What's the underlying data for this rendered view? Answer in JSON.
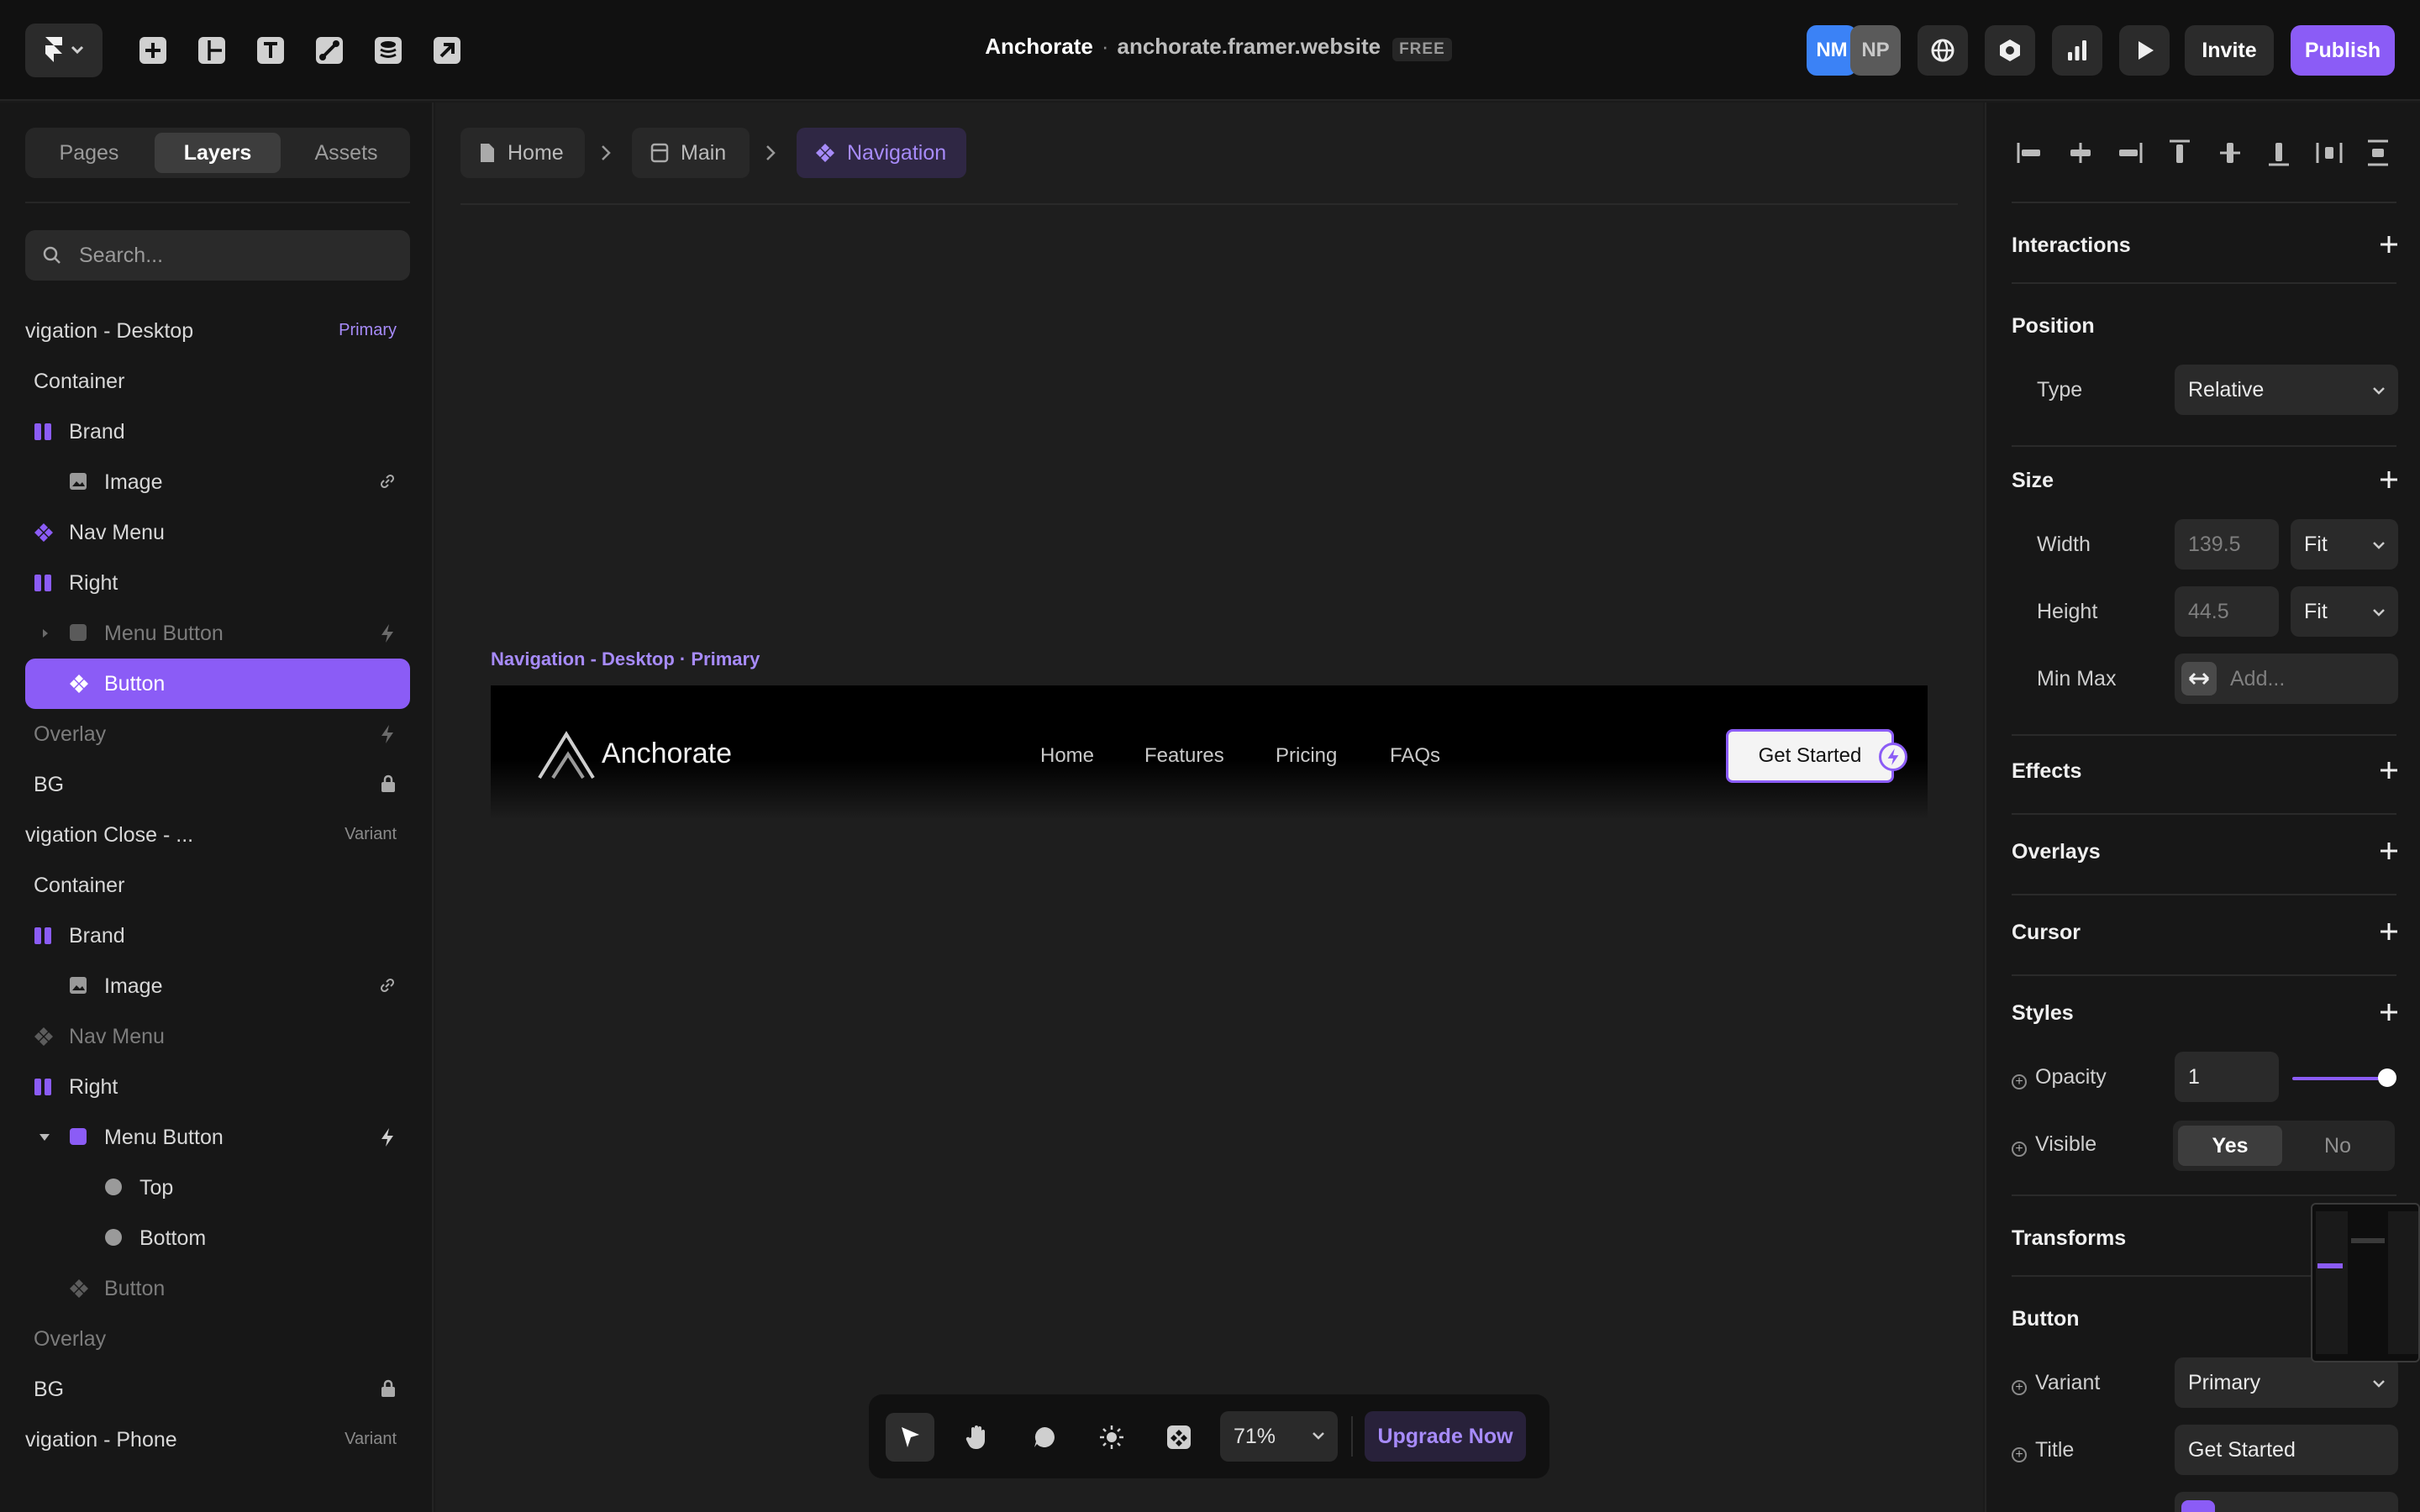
{
  "project": {
    "name": "Anchorate",
    "separator": "·",
    "domain": "anchorate.framer.website",
    "plan_badge": "FREE"
  },
  "topbar": {
    "tools": [
      "insert-icon",
      "layout-icon",
      "text-icon",
      "vector-icon",
      "cms-icon",
      "link-out-icon"
    ],
    "avatars": [
      {
        "initials": "NM",
        "color": "#3b82f6"
      },
      {
        "initials": "NP",
        "color": "#5a5a5a"
      }
    ],
    "invite_label": "Invite",
    "publish_label": "Publish"
  },
  "left_panel": {
    "tabs": [
      "Pages",
      "Layers",
      "Assets"
    ],
    "active_tab": "Layers",
    "search_placeholder": "Search...",
    "layers": [
      {
        "label": "vigation - Desktop",
        "tag": "Primary"
      },
      {
        "label": "Container"
      },
      {
        "label": "Brand"
      },
      {
        "label": "Image"
      },
      {
        "label": "Nav Menu"
      },
      {
        "label": "Right"
      },
      {
        "label": "Menu Button"
      },
      {
        "label": "Button"
      },
      {
        "label": "Overlay"
      },
      {
        "label": "BG"
      },
      {
        "label": "vigation Close - ...",
        "tag": "Variant"
      },
      {
        "label": "Container"
      },
      {
        "label": "Brand"
      },
      {
        "label": "Image"
      },
      {
        "label": "Nav Menu"
      },
      {
        "label": "Right"
      },
      {
        "label": "Menu Button"
      },
      {
        "label": "Top"
      },
      {
        "label": "Bottom"
      },
      {
        "label": "Button"
      },
      {
        "label": "Overlay"
      },
      {
        "label": "BG"
      },
      {
        "label": "vigation - Phone",
        "tag": "Variant"
      }
    ]
  },
  "canvas": {
    "breadcrumbs": [
      "Home",
      "Main",
      "Navigation"
    ],
    "frame_label": "Navigation - Desktop · Primary",
    "site": {
      "brand": "Anchorate",
      "nav_links": [
        "Home",
        "Features",
        "Pricing",
        "FAQs"
      ],
      "cta": "Get Started"
    },
    "zoom": "71%",
    "upgrade_label": "Upgrade Now"
  },
  "right_panel": {
    "interactions": "Interactions",
    "position": {
      "title": "Position",
      "type_label": "Type",
      "type_value": "Relative"
    },
    "size": {
      "title": "Size",
      "width_label": "Width",
      "width_value": "139.5",
      "width_mode": "Fit",
      "height_label": "Height",
      "height_value": "44.5",
      "height_mode": "Fit",
      "minmax_label": "Min Max",
      "minmax_placeholder": "Add..."
    },
    "effects": "Effects",
    "overlays": "Overlays",
    "cursor": "Cursor",
    "styles": {
      "title": "Styles",
      "opacity_label": "Opacity",
      "opacity_value": "1",
      "visible_label": "Visible",
      "visible_yes": "Yes",
      "visible_no": "No"
    },
    "transforms": "Transforms",
    "button": {
      "title": "Button",
      "variant_label": "Variant",
      "variant_value": "Primary",
      "title_label": "Title",
      "title_value": "Get Started"
    }
  },
  "colors": {
    "accent": "#8b5cf6",
    "accent_text": "#a78bfa",
    "panel": "#171717",
    "canvas": "#1e1e1e"
  }
}
